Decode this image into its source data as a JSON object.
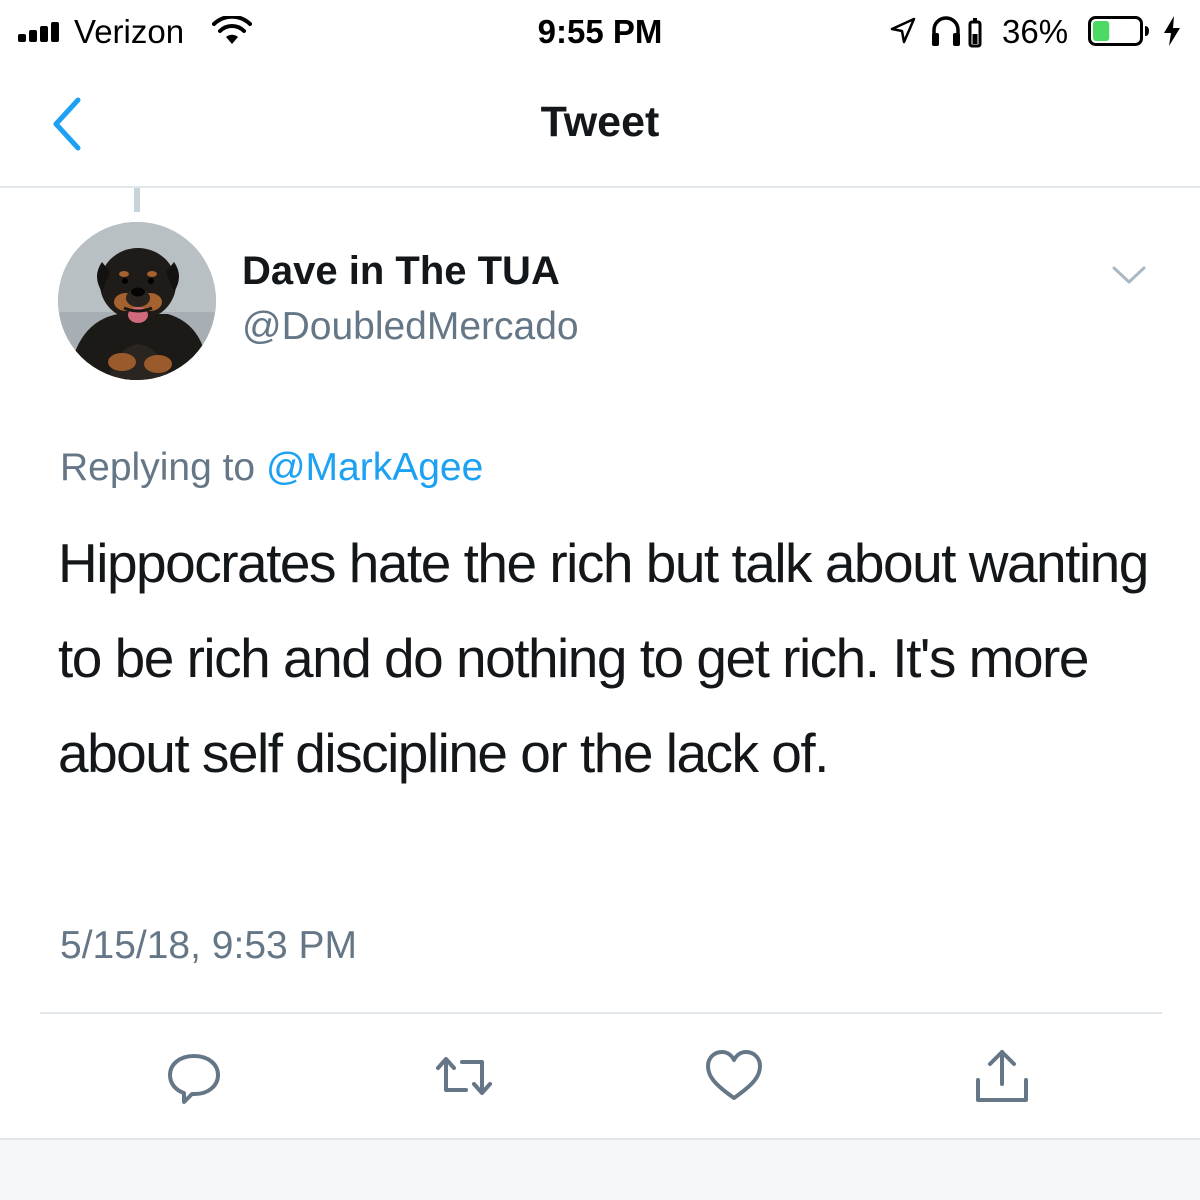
{
  "status_bar": {
    "carrier": "Verizon",
    "time": "9:55 PM",
    "battery_percent": "36%",
    "battery_level": 0.36,
    "battery_color": "#4cd964",
    "icons": [
      "signal-icon",
      "wifi-icon",
      "location-icon",
      "headphones-icon",
      "battery-icon",
      "charging-bolt-icon"
    ]
  },
  "nav": {
    "title": "Tweet",
    "back_icon": "chevron-left-icon",
    "accent_color": "#1da1f2"
  },
  "tweet": {
    "display_name": "Dave in The TUA",
    "handle": "@DoubledMercado",
    "replying_prefix": "Replying to ",
    "replying_to": "@MarkAgee",
    "text": "Hippocrates hate the rich but talk about wanting to be rich and do nothing to get rich. It's more about self discipline or the lack of.",
    "timestamp": "5/15/18, 9:53 PM",
    "avatar_icon": "rottweiler-avatar",
    "more_icon": "chevron-down-icon"
  },
  "actions": [
    {
      "name": "reply",
      "icon": "reply-icon"
    },
    {
      "name": "retweet",
      "icon": "retweet-icon"
    },
    {
      "name": "like",
      "icon": "heart-icon"
    },
    {
      "name": "share",
      "icon": "share-icon"
    }
  ]
}
